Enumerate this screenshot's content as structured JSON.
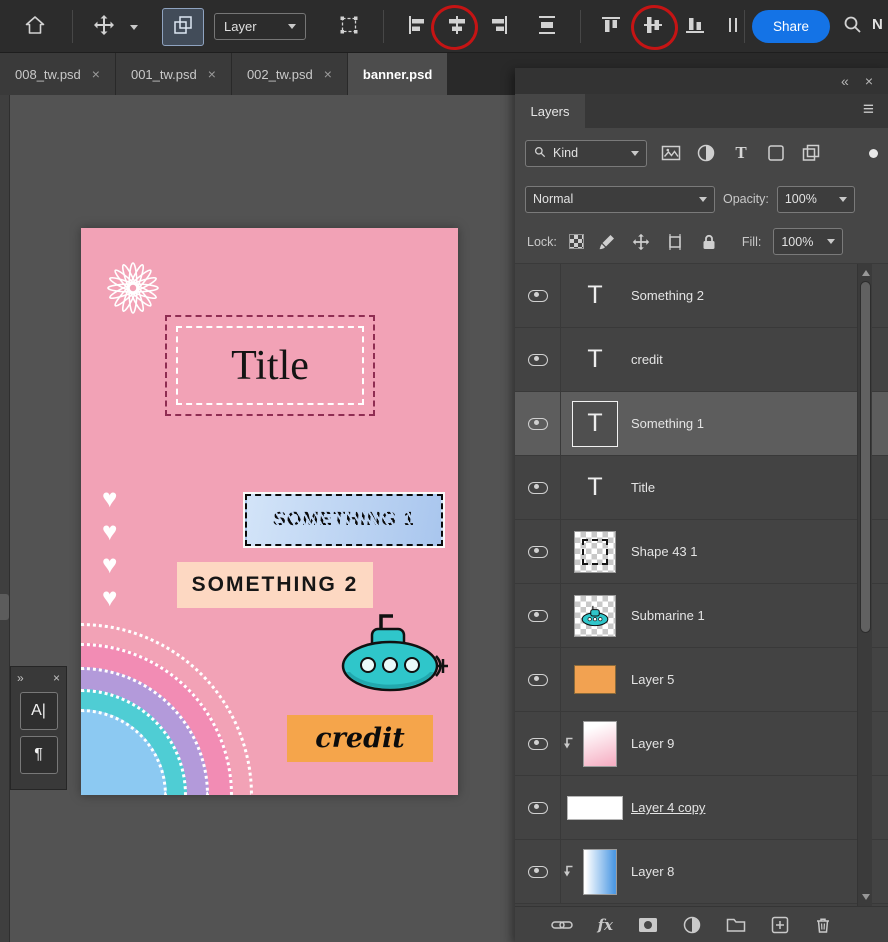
{
  "colors": {
    "share_blue": "#1473e6",
    "poster_pink": "#f2a2b6",
    "blue_box": "#b9d2f1",
    "peach_box": "#fdd8c2",
    "orange_box": "#f5a54b",
    "submarine_teal": "#2fc6ca",
    "annotation_red": "#c51414",
    "selected_layer_bg": "#5d5d5d"
  },
  "toolbar": {
    "layer_dropdown_label": "Layer",
    "share_label": "Share",
    "clipped_right_label": "N"
  },
  "tabs": [
    {
      "label": "008_tw.psd"
    },
    {
      "label": "001_tw.psd"
    },
    {
      "label": "002_tw.psd"
    },
    {
      "label": "banner.psd"
    }
  ],
  "glyphs": {
    "close": "×",
    "collapse_left": "«",
    "expand_right": "»",
    "menu": "≡",
    "text_layer": "T",
    "heart": "♥",
    "character_panel": "A|",
    "paragraph_panel": "¶",
    "fx": "fx"
  },
  "layers_panel": {
    "title": "Layers",
    "kind_filter_label": "Kind",
    "blend_mode": "Normal",
    "opacity_label": "Opacity:",
    "opacity_value": "100%",
    "lock_label": "Lock:",
    "fill_label": "Fill:",
    "fill_value": "100%",
    "layers": [
      {
        "name": "Something 2",
        "kind": "text"
      },
      {
        "name": "credit",
        "kind": "text"
      },
      {
        "name": "Something 1",
        "kind": "text",
        "selected": true
      },
      {
        "name": "Title",
        "kind": "text"
      },
      {
        "name": "Shape 43 1",
        "kind": "shape"
      },
      {
        "name": "Submarine 1",
        "kind": "image"
      },
      {
        "name": "Layer 5",
        "kind": "fill"
      },
      {
        "name": "Layer 9",
        "kind": "gradient",
        "clipped": true
      },
      {
        "name": "Layer 4 copy",
        "kind": "fill",
        "underlined": true
      },
      {
        "name": "Layer 8",
        "kind": "gradient",
        "clipped": true
      }
    ]
  },
  "poster": {
    "title": "Title",
    "something1_label": "SOMETHING 1",
    "something2_label": "SOMETHING 2",
    "credit_label": "credit"
  }
}
